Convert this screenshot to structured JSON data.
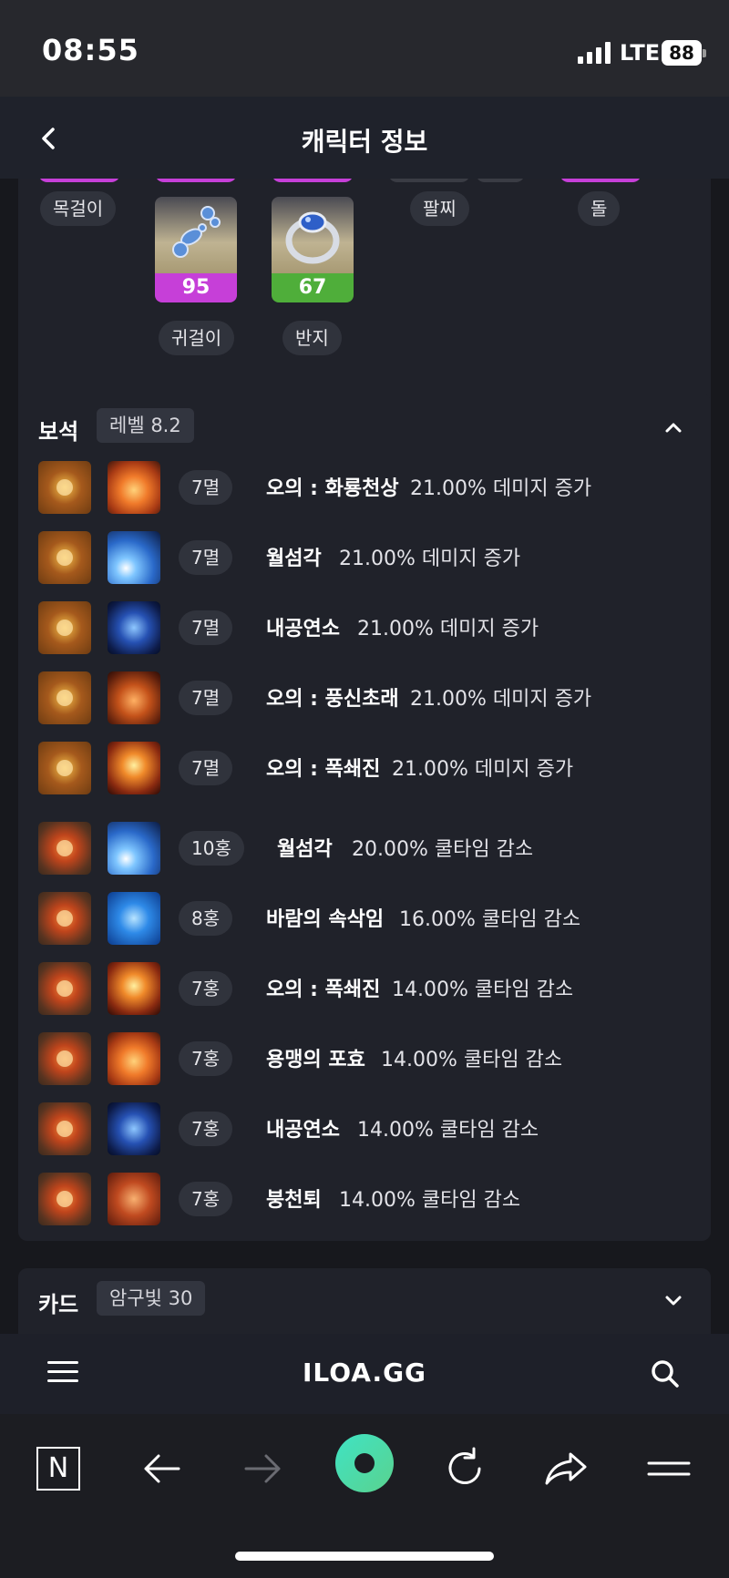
{
  "status": {
    "time": "08:55",
    "network": "LTE",
    "battery": "88"
  },
  "header": {
    "title": "캐릭터 정보"
  },
  "accessories": {
    "labels": {
      "necklace": "목걸이",
      "earring": "귀걸이",
      "ring": "반지",
      "bracelet": "팔찌",
      "stone": "돌"
    },
    "items": [
      {
        "label": "귀걸이",
        "quality": "95",
        "color": "#c63fd8"
      },
      {
        "label": "반지",
        "quality": "67",
        "color": "#4fae3a"
      }
    ]
  },
  "gems": {
    "title": "보석",
    "badge": "레벨 8.2",
    "rows": [
      {
        "level": "7멸",
        "skill": "오의 : 화룡천상",
        "effect": "21.00% 데미지 증가",
        "gem_icon": "damage-gem",
        "skill_icon": "fire"
      },
      {
        "level": "7멸",
        "skill": "월섬각",
        "effect": "21.00% 데미지 증가",
        "gem_icon": "damage-gem",
        "skill_icon": "blue-slash"
      },
      {
        "level": "7멸",
        "skill": "내공연소",
        "effect": "21.00% 데미지 증가",
        "gem_icon": "damage-gem",
        "skill_icon": "swirl"
      },
      {
        "level": "7멸",
        "skill": "오의 : 풍신초래",
        "effect": "21.00% 데미지 증가",
        "gem_icon": "damage-gem",
        "skill_icon": "storm"
      },
      {
        "level": "7멸",
        "skill": "오의 : 폭쇄진",
        "effect": "21.00% 데미지 증가",
        "gem_icon": "damage-gem",
        "skill_icon": "burst"
      },
      {
        "level": "10홍",
        "skill": "월섬각",
        "effect": "20.00% 쿨타임 감소",
        "gem_icon": "cooldown-gem",
        "skill_icon": "blue-slash"
      },
      {
        "level": "8홍",
        "skill": "바람의 속삭임",
        "effect": "16.00% 쿨타임 감소",
        "gem_icon": "cooldown-gem",
        "skill_icon": "runner"
      },
      {
        "level": "7홍",
        "skill": "오의 : 폭쇄진",
        "effect": "14.00% 쿨타임 감소",
        "gem_icon": "cooldown-gem",
        "skill_icon": "burst"
      },
      {
        "level": "7홍",
        "skill": "용맹의 포효",
        "effect": "14.00% 쿨타임 감소",
        "gem_icon": "cooldown-gem",
        "skill_icon": "fire"
      },
      {
        "level": "7홍",
        "skill": "내공연소",
        "effect": "14.00% 쿨타임 감소",
        "gem_icon": "cooldown-gem",
        "skill_icon": "swirl"
      },
      {
        "level": "7홍",
        "skill": "붕천퇴",
        "effect": "14.00% 쿨타임 감소",
        "gem_icon": "cooldown-gem",
        "skill_icon": "kick"
      }
    ]
  },
  "cards": {
    "title": "카드",
    "badge": "암구빛 30"
  },
  "site": {
    "logo": "ILOA.GG"
  },
  "browser": {
    "n_label": "N"
  },
  "colors": {
    "accent_purple": "#c63fd8",
    "accent_green": "#4fae3a",
    "bg": "#17181d",
    "card": "#20222a"
  }
}
